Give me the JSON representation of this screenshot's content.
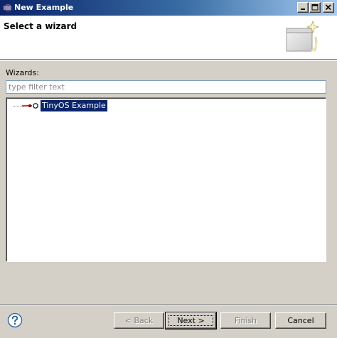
{
  "window": {
    "title": "New Example"
  },
  "header": {
    "page_title": "Select a wizard"
  },
  "wizards": {
    "label": "Wizards:",
    "filter_placeholder": "type filter text",
    "items": [
      {
        "label": "TinyOS Example",
        "selected": true
      }
    ]
  },
  "buttons": {
    "back": "< Back",
    "next": "Next >",
    "finish": "Finish",
    "cancel": "Cancel"
  },
  "icons": {
    "app": "eclipse-icon",
    "help": "help-icon",
    "wizard_banner": "wizard-banner-icon",
    "tree_node": "example-node-icon"
  },
  "colors": {
    "title_bar": "#0a246a",
    "selection": "#0a246a",
    "dialog_bg": "#d4d0c8",
    "help_icon": "#3a6ea5"
  }
}
